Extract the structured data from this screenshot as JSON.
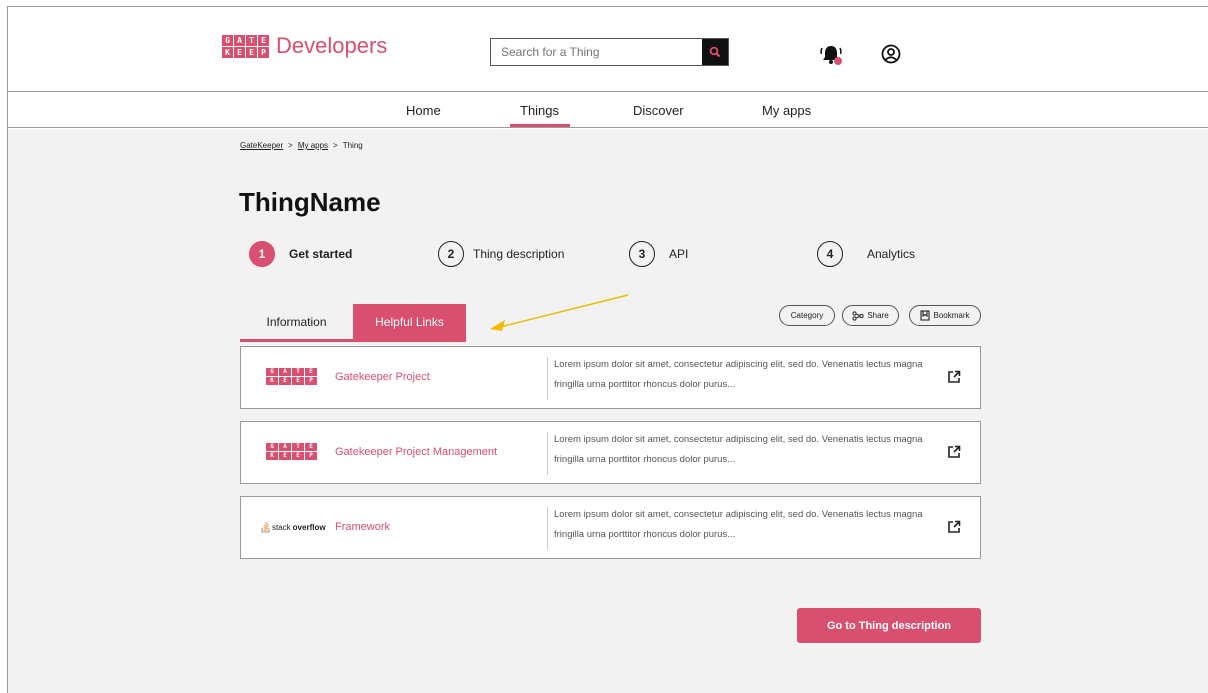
{
  "brand": {
    "logo_letters": [
      "G",
      "A",
      "T",
      "E",
      "K",
      "E",
      "E",
      "P",
      "E",
      "R"
    ],
    "title": "Developers",
    "accent_color": "#d94f6f"
  },
  "search": {
    "placeholder": "Search for a Thing",
    "icon": "search-icon"
  },
  "header_icons": {
    "notifications": "bell-icon",
    "account": "user-icon"
  },
  "nav": {
    "items": [
      {
        "label": "Home"
      },
      {
        "label": "Things",
        "active": true
      },
      {
        "label": "Discover"
      },
      {
        "label": "My apps"
      }
    ]
  },
  "breadcrumb": {
    "items": [
      "GateKeeper",
      "My apps",
      "Thing"
    ],
    "separator": ">"
  },
  "page": {
    "title": "ThingName"
  },
  "steps": [
    {
      "number": "1",
      "label": "Get started",
      "active": true
    },
    {
      "number": "2",
      "label": "Thing description"
    },
    {
      "number": "3",
      "label": "API"
    },
    {
      "number": "4",
      "label": "Analytics"
    }
  ],
  "tabs": [
    {
      "label": "Information"
    },
    {
      "label": "Helpful Links",
      "active": true
    }
  ],
  "actions": {
    "category": "Category",
    "share": "Share",
    "bookmark": "Bookmark"
  },
  "links": [
    {
      "logo": "gatekeeper-logo",
      "title": "Gatekeeper Project",
      "description": "Lorem ipsum dolor sit amet, consectetur adipiscing elit, sed do. Venenatis lectus magna fringilla urna porttitor rhoncus dolor purus..."
    },
    {
      "logo": "gatekeeper-logo",
      "title": "Gatekeeper Project Management",
      "description": "Lorem ipsum dolor sit amet, consectetur adipiscing elit, sed do. Venenatis lectus magna fringilla urna porttitor rhoncus dolor purus..."
    },
    {
      "logo": "stackoverflow-logo",
      "logo_text_light": "stack",
      "logo_text_bold": "overflow",
      "title": "Framework",
      "description": "Lorem ipsum dolor sit amet, consectetur adipiscing elit, sed do. Venenatis lectus magna fringilla urna porttitor rhoncus dolor purus..."
    }
  ],
  "cta": {
    "label": "Go to Thing description"
  }
}
